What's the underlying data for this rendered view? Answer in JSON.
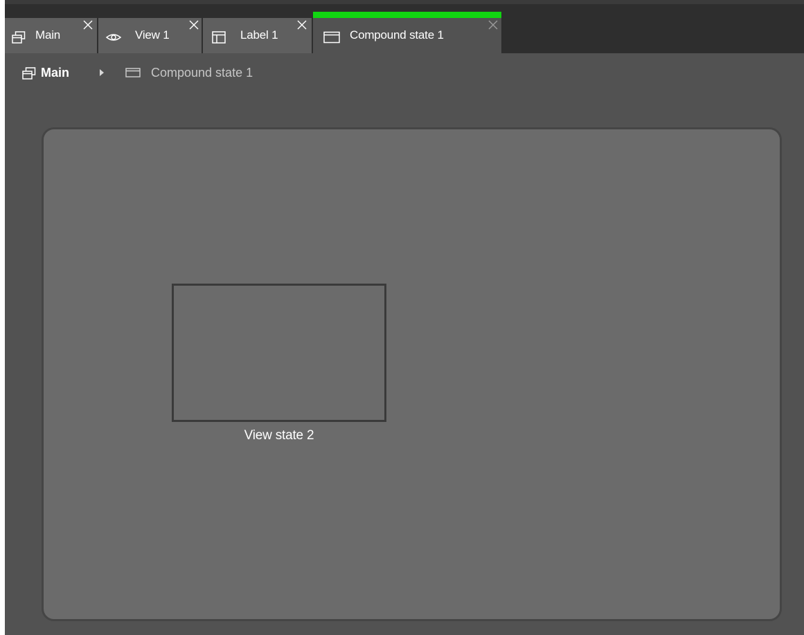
{
  "tabs": [
    {
      "label": "Main",
      "icon": "stacked-windows-icon",
      "active": false
    },
    {
      "label": "View 1",
      "icon": "eye-icon",
      "active": false
    },
    {
      "label": "Label 1",
      "icon": "layout-panel-icon",
      "active": false
    },
    {
      "label": "Compound state 1",
      "icon": "window-icon",
      "active": true
    }
  ],
  "breadcrumb": {
    "root": {
      "label": "Main",
      "icon": "stacked-windows-icon"
    },
    "separator_icon": "chevron-right-icon",
    "current": {
      "label": "Compound state 1",
      "icon": "window-icon"
    }
  },
  "canvas": {
    "states": [
      {
        "label": "View state 2"
      }
    ]
  },
  "colors": {
    "active_tab_accent": "#11d611",
    "tab_background": "#5f5f5f",
    "workspace_background": "#525252",
    "canvas_background": "#6b6b6b"
  }
}
